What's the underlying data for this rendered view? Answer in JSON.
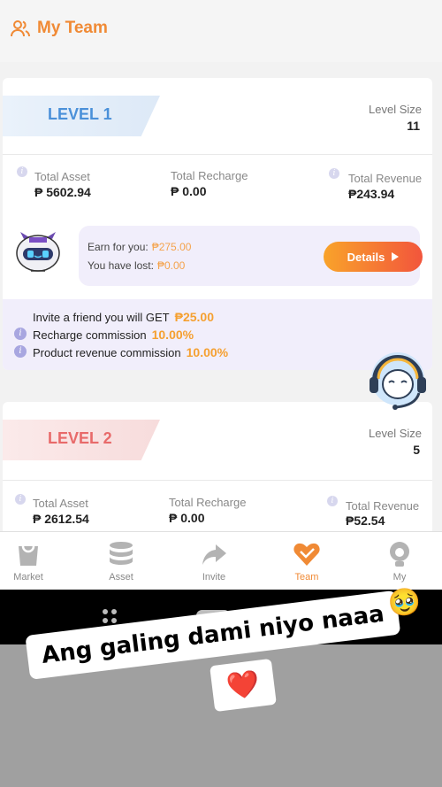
{
  "header": {
    "title": "My Team"
  },
  "levels": [
    {
      "name": "LEVEL 1",
      "size_label": "Level Size",
      "size": "11",
      "total_asset_label": "Total Asset",
      "total_asset": "₱ 5602.94",
      "total_recharge_label": "Total Recharge",
      "total_recharge": "₱ 0.00",
      "total_revenue_label": "Total Revenue",
      "total_revenue": "₱243.94"
    },
    {
      "name": "LEVEL 2",
      "size_label": "Level Size",
      "size": "5",
      "total_asset_label": "Total Asset",
      "total_asset": "₱ 2612.54",
      "total_recharge_label": "Total Recharge",
      "total_recharge": "₱ 0.00",
      "total_revenue_label": "Total Revenue",
      "total_revenue": "₱52.54"
    }
  ],
  "earnings": {
    "earn_label": "Earn for you:",
    "earn_value": "₱275.00",
    "lost_label": "You have lost:",
    "lost_value": "₱0.00"
  },
  "invite": {
    "friend_label": "Invite a friend you will GET",
    "friend_value": "₱25.00",
    "recharge_label": "Recharge commission",
    "recharge_value": "10.00%",
    "product_label": "Product revenue commission",
    "product_value": "10.00%",
    "details_label": "Details"
  },
  "tabs": [
    {
      "label": "Market",
      "icon": "bag-icon"
    },
    {
      "label": "Asset",
      "icon": "database-icon"
    },
    {
      "label": "Invite",
      "icon": "share-arrow-icon"
    },
    {
      "label": "Team",
      "icon": "handshake-heart-icon",
      "active": true
    },
    {
      "label": "My",
      "icon": "profile-icon"
    }
  ],
  "sticker": {
    "text": "Ang galing dami niyo naaa",
    "emoji": "🥹",
    "heart": "❤️"
  },
  "colors": {
    "accent": "#f08a35",
    "level1": "#4a90d9",
    "level2": "#e86a6a"
  }
}
